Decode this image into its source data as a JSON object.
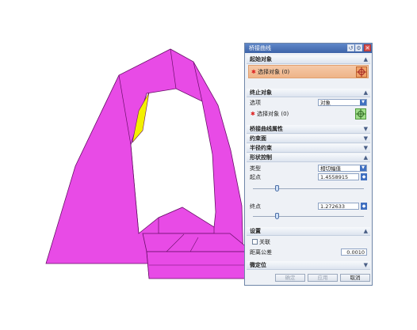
{
  "dialog": {
    "title": "桥接曲线",
    "titlebar_buttons": [
      "reset-icon",
      "settings-icon",
      "close-icon"
    ],
    "sections": {
      "start_object": {
        "label": "起始对象",
        "select_label": "选择对象 (0)"
      },
      "end_object": {
        "label": "终止对象",
        "option_label": "选项",
        "option_value": "对象",
        "select_label": "选择对象 (0)"
      },
      "bridge_props": {
        "label": "桥接曲线属性"
      },
      "constraint_face": {
        "label": "约束面"
      },
      "radius_constraint": {
        "label": "半径约束"
      },
      "shape_control": {
        "label": "形状控制",
        "type_label": "类型",
        "type_value": "相切幅值",
        "start_label": "起点",
        "start_value": "1.4558915",
        "end_label": "终点",
        "end_value": "1.272633"
      },
      "settings": {
        "label": "设置",
        "associative_label": "关联",
        "distance_tol_label": "距离公差",
        "distance_tol_value": "0.0010"
      },
      "fine_tune": {
        "label": "微定位"
      }
    },
    "buttons": {
      "ok": "确定",
      "apply": "应用",
      "cancel": "取消"
    }
  },
  "colors": {
    "model_magenta": "#e84be6",
    "model_dark": "#b8159f",
    "highlight_yellow": "#f3f000",
    "accent": "#f0a26a"
  }
}
